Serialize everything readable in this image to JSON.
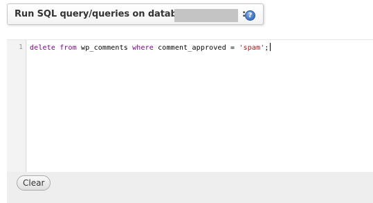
{
  "header": {
    "title": "Run SQL query/queries on database",
    "colon": ":",
    "help_icon": "help-question-icon",
    "help_glyph": "?"
  },
  "editor": {
    "line_numbers": [
      "1"
    ],
    "tokens": {
      "kw_delete": "delete",
      "sp1": " ",
      "kw_from": "from",
      "table": " wp_comments ",
      "kw_where": "where",
      "condition": " comment_approved = ",
      "string_value": "'spam'",
      "terminator": ";"
    }
  },
  "actions": {
    "clear_label": "Clear"
  },
  "colors": {
    "keyword": "#770088",
    "string": "#aa1111",
    "gutter_bg": "#f3f3f3",
    "bottom_bar_bg": "#eeeeee"
  }
}
